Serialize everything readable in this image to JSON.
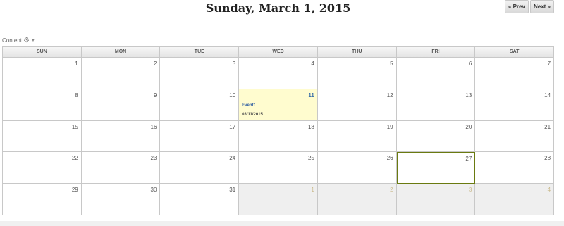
{
  "header": {
    "title": "Sunday, March 1, 2015",
    "prev_label": "« Prev",
    "next_label": "Next »"
  },
  "toolbar": {
    "content_label": "Content",
    "gear_icon": "gear-icon",
    "caret_icon": "chevron-down-icon"
  },
  "calendar": {
    "day_headers": [
      "SUN",
      "MON",
      "TUE",
      "WED",
      "THU",
      "FRI",
      "SAT"
    ],
    "weeks": [
      [
        "1",
        "2",
        "3",
        "4",
        "5",
        "6",
        "7"
      ],
      [
        "8",
        "9",
        "10",
        "11",
        "12",
        "13",
        "14"
      ],
      [
        "15",
        "16",
        "17",
        "18",
        "19",
        "20",
        "21"
      ],
      [
        "22",
        "23",
        "24",
        "25",
        "26",
        "27",
        "28"
      ],
      [
        "29",
        "30",
        "31",
        "1",
        "2",
        "3",
        "4"
      ]
    ],
    "event": {
      "title": "Event1",
      "date": "03/11/2015"
    },
    "colors": {
      "event_bg": "#fffccf",
      "today_border": "#6a7a10",
      "other_month_bg": "#efefef",
      "other_month_text": "#c9b98a"
    }
  }
}
